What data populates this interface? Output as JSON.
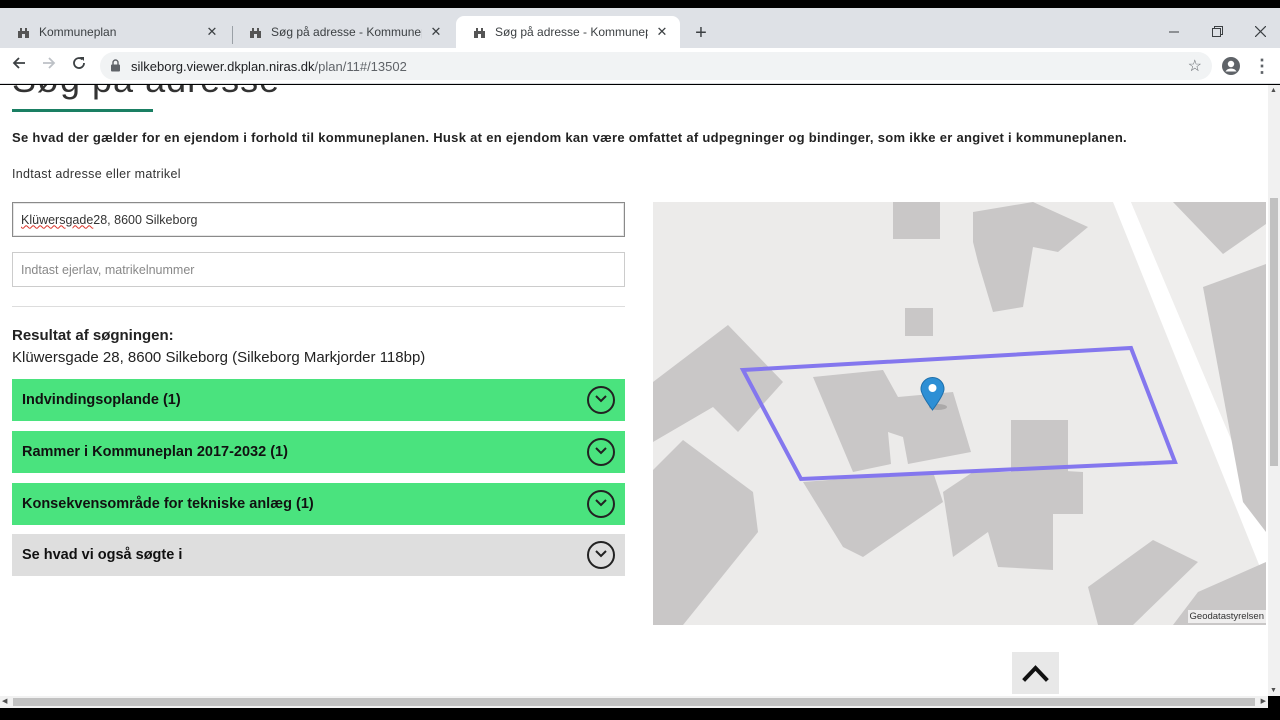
{
  "browser": {
    "tabs": [
      {
        "title": "Kommuneplan",
        "active": false
      },
      {
        "title": "Søg på adresse - Kommuneplan",
        "active": false
      },
      {
        "title": "Søg på adresse - Kommuneplan",
        "active": true
      }
    ],
    "new_tab_label": "+",
    "url_host": "silkeborg.viewer.dkplan.niras.dk",
    "url_path": "/plan/11#/13502",
    "window_controls": [
      "minimize",
      "restore",
      "close"
    ]
  },
  "page": {
    "heading": "Søg på adresse",
    "intro": "Se hvad der gælder for en ejendom i forhold til kommuneplanen. Husk at en ejendom kan være omfattet af udpegninger og bindinger, som ikke er angivet i kommuneplanen.",
    "field_label": "Indtast adresse eller matrikel",
    "address_input": {
      "value_part1": "Klüwersgade",
      "value_part2": " 28, 8600 Silkeborg"
    },
    "matrikel_input": {
      "placeholder": "Indtast ejerlav, matrikelnummer"
    },
    "result_title": "Resultat af søgningen:",
    "result_text": "Klüwersgade 28, 8600 Silkeborg (Silkeborg Markjorder 118bp)",
    "accordions": [
      {
        "label": "Indvindingsoplande (1)",
        "color": "#4ae37e"
      },
      {
        "label": "Rammer i Kommuneplan 2017-2032 (1)",
        "color": "#4ae37e"
      },
      {
        "label": "Konsekvensområde for tekniske anlæg (1)",
        "color": "#4ae37e"
      },
      {
        "label": "Se hvad vi også søgte i",
        "color": "#dedede"
      }
    ],
    "map": {
      "attribution": "Geodatastyrelsen",
      "parcel_color": "#8477ee",
      "marker_color": "#2d8fd5"
    }
  }
}
